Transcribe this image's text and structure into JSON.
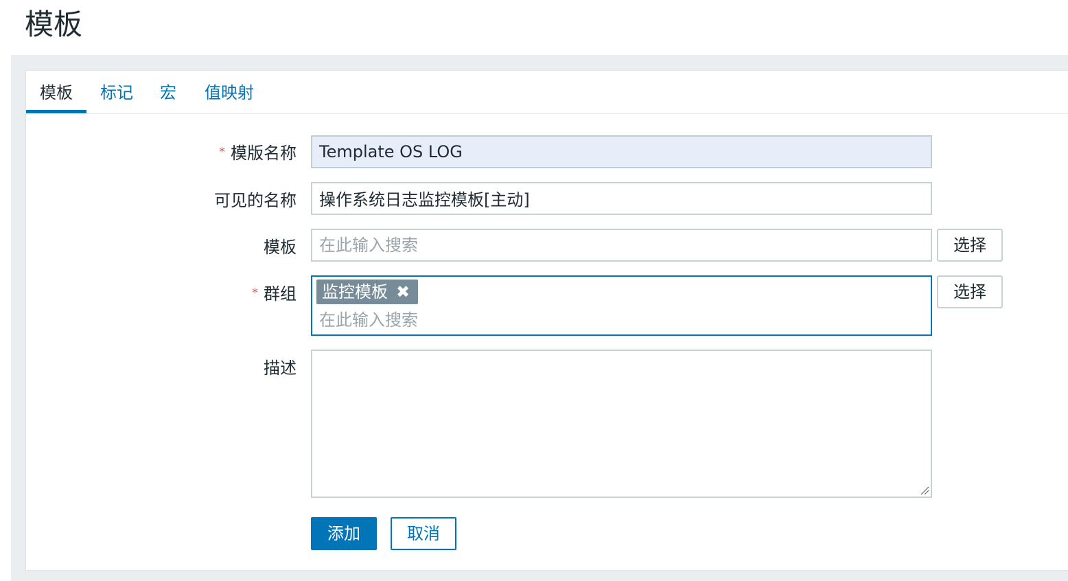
{
  "header": {
    "title": "模板"
  },
  "tabs": [
    {
      "label": "模板",
      "active": true
    },
    {
      "label": "标记",
      "active": false
    },
    {
      "label": "宏",
      "active": false
    },
    {
      "label": "值映射",
      "active": false
    }
  ],
  "form": {
    "required_mark": "*",
    "template_name": {
      "label": "模版名称",
      "value": "Template OS LOG"
    },
    "visible_name": {
      "label": "可见的名称",
      "value": "操作系统日志监控模板[主动]"
    },
    "templates": {
      "label": "模板",
      "placeholder": "在此输入搜索",
      "select_label": "选择"
    },
    "groups": {
      "label": "群组",
      "chips": [
        {
          "label": "监控模板",
          "remove": "✖"
        }
      ],
      "placeholder": "在此输入搜索",
      "select_label": "选择"
    },
    "description": {
      "label": "描述",
      "value": ""
    }
  },
  "actions": {
    "add_label": "添加",
    "cancel_label": "取消"
  },
  "colors": {
    "accent": "#0275b8",
    "required": "#e45959",
    "chip": "#768d99",
    "focused_field": "#e8eef9"
  }
}
